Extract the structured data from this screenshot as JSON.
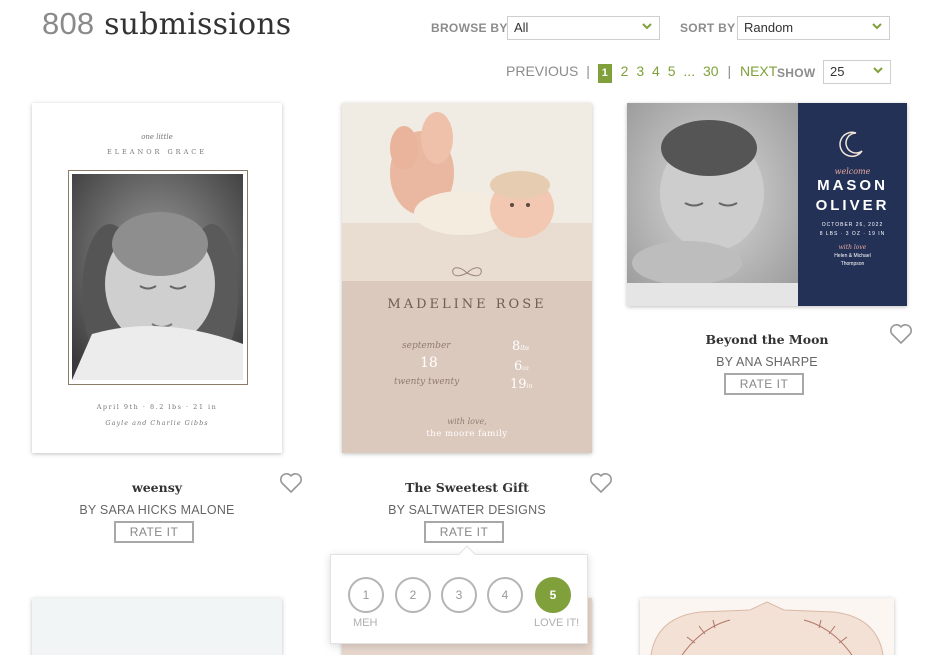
{
  "header": {
    "count": "808",
    "title_suffix": "submissions",
    "browse_label": "BROWSE BY",
    "browse_value": "All",
    "sort_label": "SORT BY",
    "sort_value": "Random"
  },
  "pagination": {
    "previous": "PREVIOUS",
    "sep1": "|",
    "current": "1",
    "pages": [
      "2",
      "3",
      "4",
      "5"
    ],
    "ellipsis": "...",
    "last": "30",
    "sep2": "|",
    "next": "NEXT",
    "show_label": "SHOW",
    "show_value": "25"
  },
  "cards": [
    {
      "title": "weensy",
      "by": "BY SARA HICKS MALONE",
      "rate": "RATE IT",
      "art": {
        "line1": "one little",
        "line2": "ELEANOR GRACE",
        "line3": "April 9th · 8.2 lbs · 21 in",
        "line4": "Gayle and Charlie Gibbs"
      }
    },
    {
      "title": "The Sweetest Gift",
      "by": "BY SALTWATER DESIGNS",
      "rate": "RATE IT",
      "art": {
        "name": "MADELINE ROSE",
        "month_word": "september",
        "day": "18",
        "year_word": "twenty twenty",
        "lbs": "8",
        "lbs_unit": "lbs",
        "oz": "6",
        "oz_unit": "oz",
        "inches": "19",
        "in_unit": "in",
        "closing": "with love,",
        "family": "the moore family"
      }
    },
    {
      "title": "Beyond the Moon",
      "by": "BY ANA SHARPE",
      "rate": "RATE IT",
      "art": {
        "welcome": "welcome",
        "first": "MASON",
        "last": "OLIVER",
        "date": "OCTOBER 26, 2022",
        "stats": "8 LBS · 3 OZ · 19 IN",
        "with_love": "with love",
        "parents": "Helen & Michael",
        "surname": "Thompson"
      }
    }
  ],
  "rating_popup": {
    "options": [
      "1",
      "2",
      "3",
      "4",
      "5"
    ],
    "selected": "5",
    "low_caption": "MEH",
    "high_caption": "LOVE IT!"
  },
  "colors": {
    "accent": "#7fa03a",
    "card2_panel": "#dcc9bd",
    "card3_panel": "#233157"
  },
  "icons": {
    "heart": "heart-outline-icon",
    "chevron": "chevron-down-icon"
  }
}
